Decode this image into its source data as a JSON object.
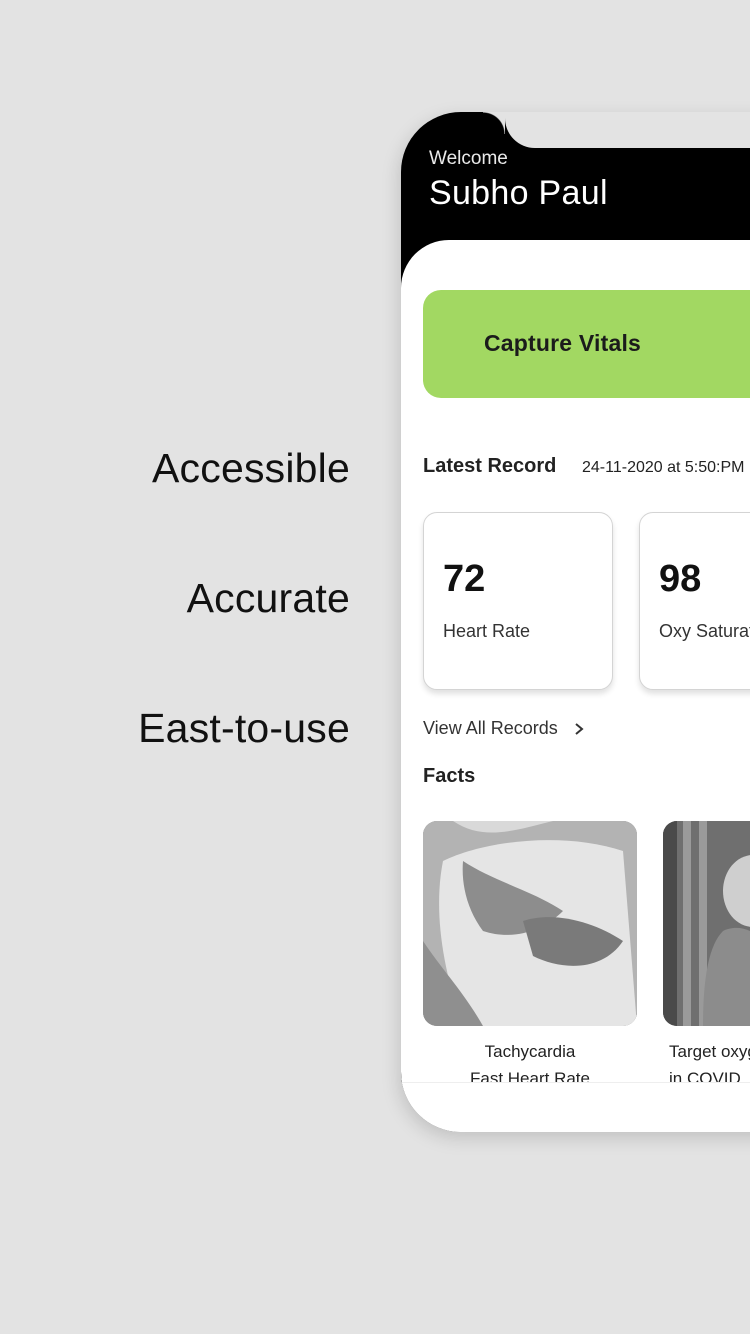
{
  "features": [
    "Accessible",
    "Accurate",
    "East-to-use"
  ],
  "header": {
    "welcome": "Welcome",
    "username": "Subho Paul"
  },
  "capture": {
    "label": "Capture Vitals",
    "icon": "heart-icon"
  },
  "latest_record": {
    "title": "Latest Record",
    "date": "24-11-2020 at 5:50:PM"
  },
  "vitals": [
    {
      "value": "72",
      "label": "Heart Rate"
    },
    {
      "value": "98",
      "label": "Oxy Saturation"
    }
  ],
  "view_all": {
    "label": "View All Records",
    "icon": "chevron-right-icon"
  },
  "facts": {
    "title": "Facts",
    "items": [
      {
        "line1": "Tachycardia",
        "line2": "Fast Heart Rate"
      },
      {
        "line1": "Target oxygen",
        "line2": "in COVID"
      }
    ]
  },
  "colors": {
    "background": "#e3e3e3",
    "header": "#000000",
    "accent_green": "#a2d862"
  }
}
